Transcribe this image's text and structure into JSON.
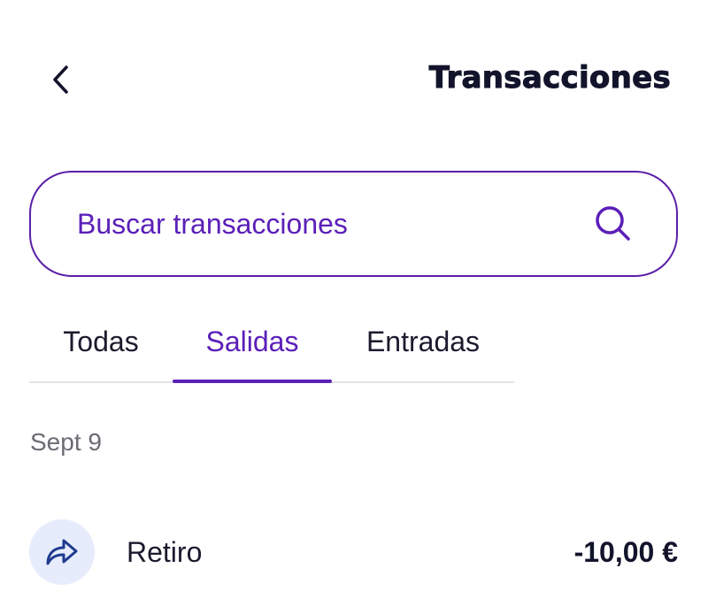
{
  "header": {
    "back_icon": "chevron-left-icon",
    "title": "Transacciones"
  },
  "search": {
    "placeholder": "Buscar transacciones",
    "icon": "search-icon",
    "accent_color": "#5b1fb8"
  },
  "tabs": [
    {
      "label": "Todas",
      "selected": false
    },
    {
      "label": "Salidas",
      "selected": true
    },
    {
      "label": "Entradas",
      "selected": false
    }
  ],
  "transactions": {
    "groups": [
      {
        "date": "Sept 9",
        "items": [
          {
            "icon": "share-arrow-icon",
            "name": "Retiro",
            "amount": "-10,00 €"
          }
        ]
      }
    ]
  }
}
